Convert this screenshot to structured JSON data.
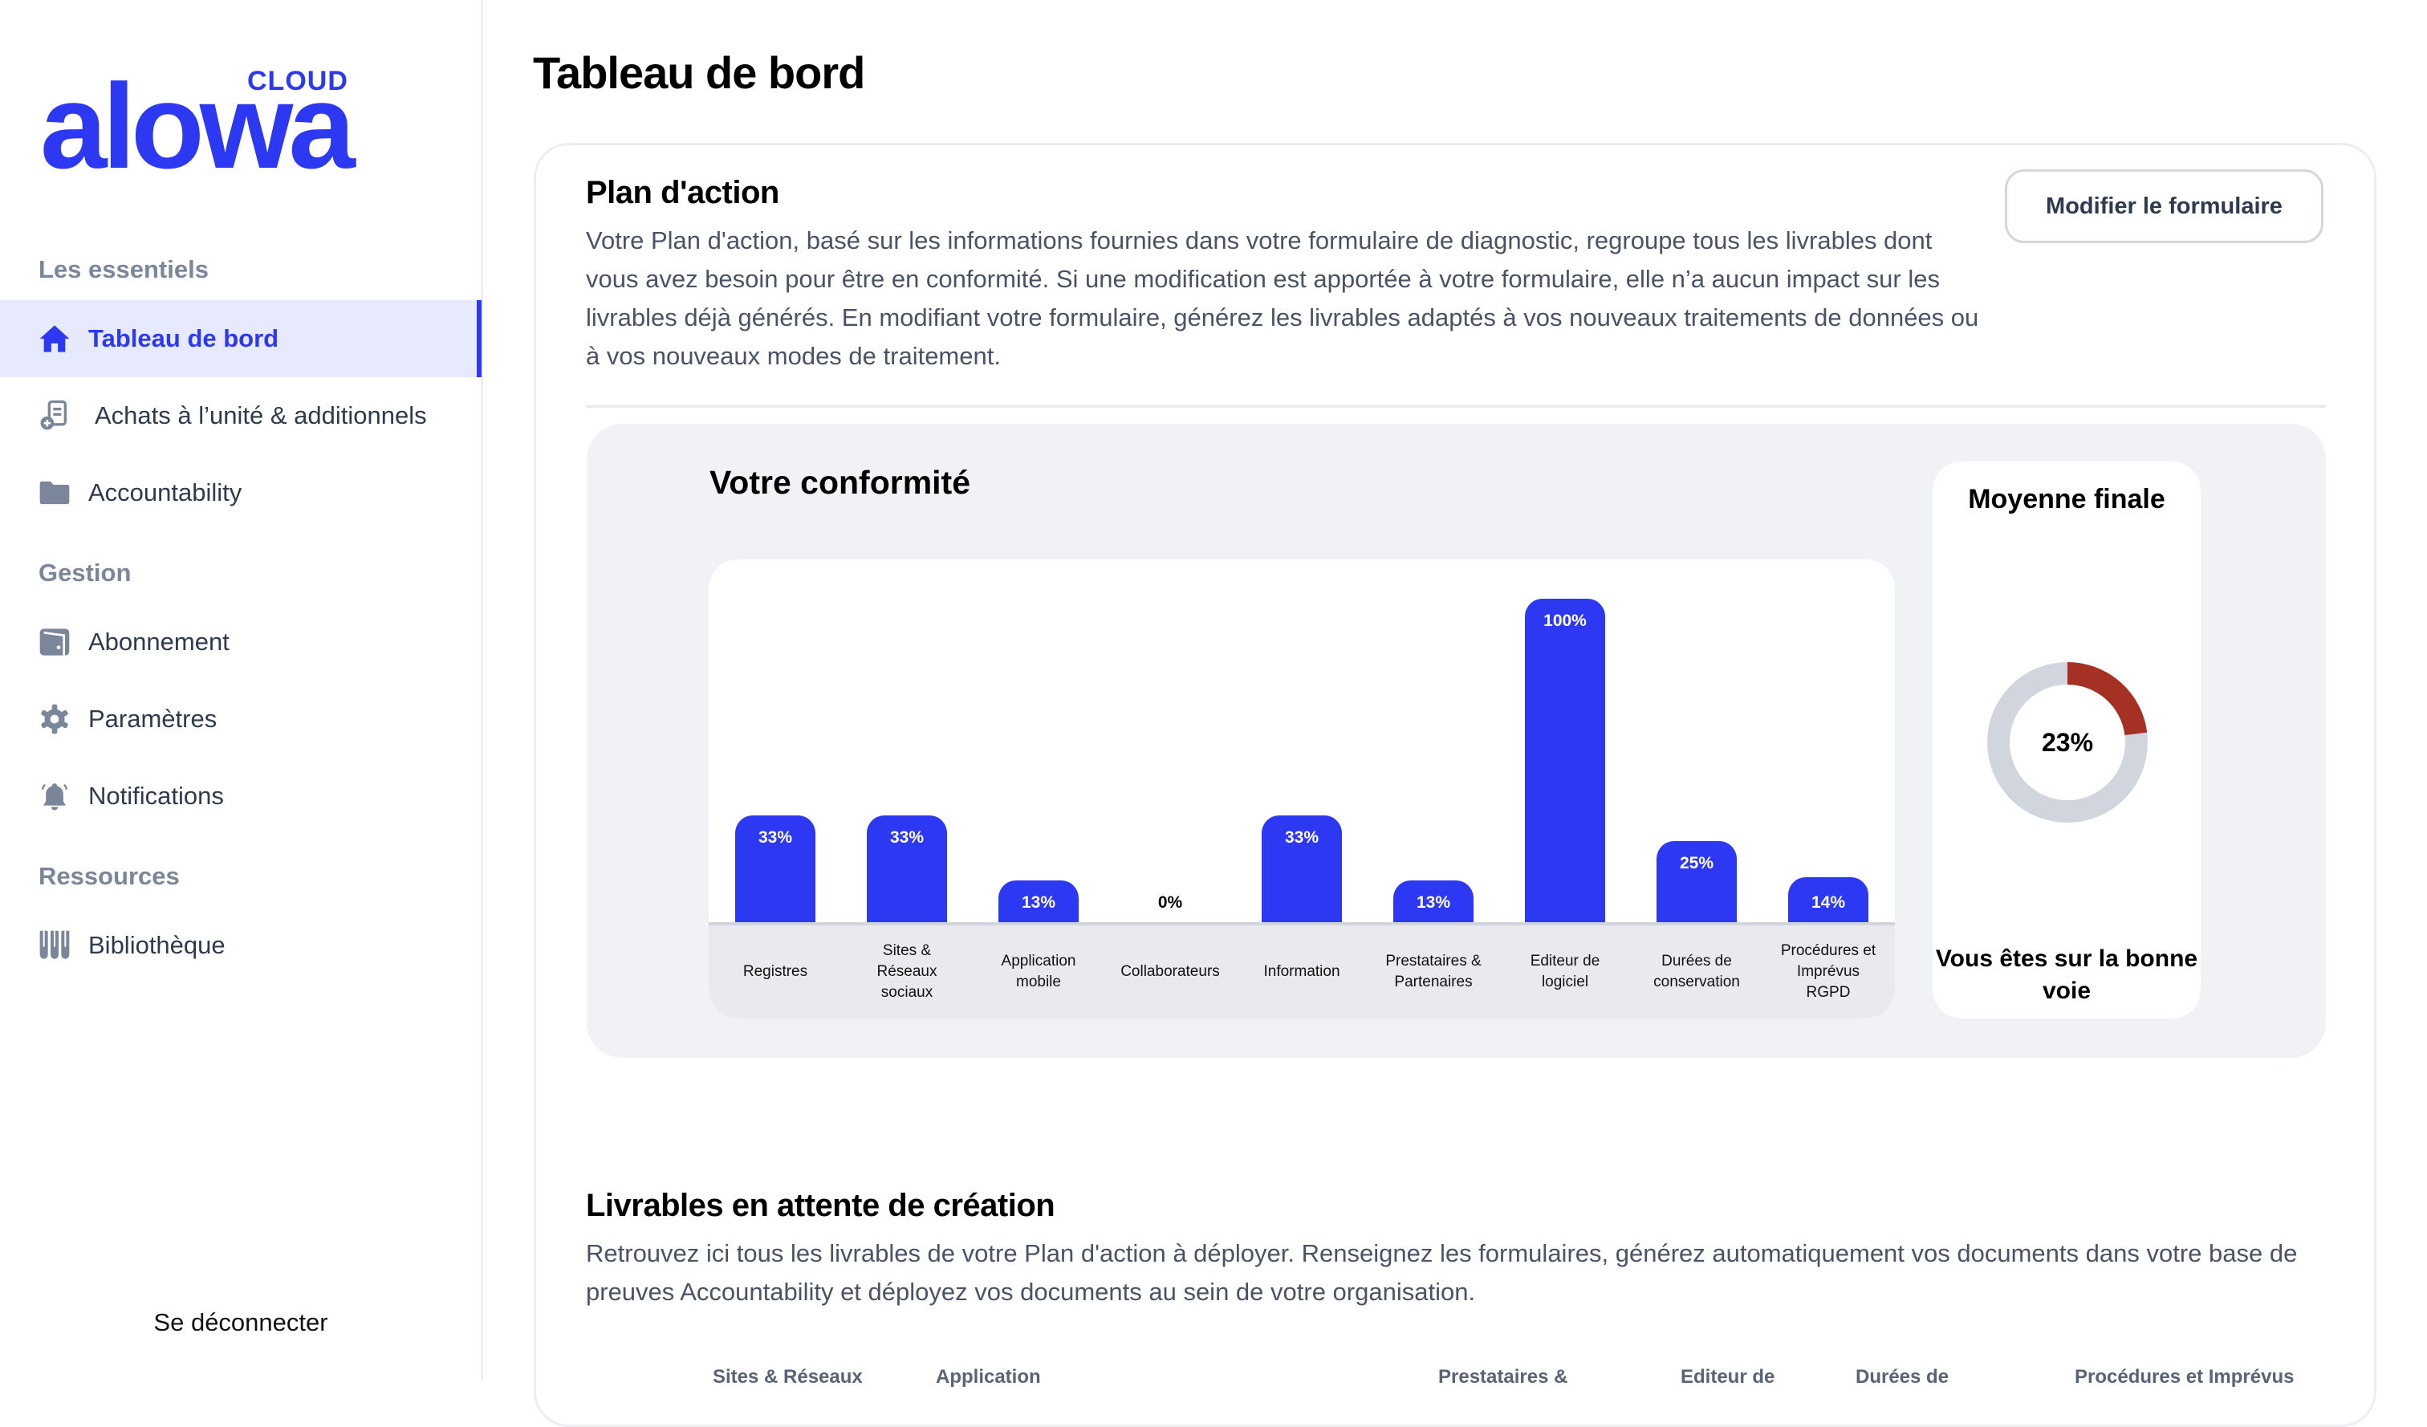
{
  "brand": {
    "name": "alowa",
    "suffix": "CLOUD",
    "accent": "#2d38f2"
  },
  "sidebar": {
    "sections": [
      {
        "label": "Les essentiels"
      },
      {
        "label": "Gestion"
      },
      {
        "label": "Ressources"
      }
    ],
    "items": [
      {
        "label": "Tableau de bord",
        "icon": "home-icon",
        "active": true
      },
      {
        "label": "Achats à l’unité & additionnels",
        "icon": "document-add-icon"
      },
      {
        "label": "Accountability",
        "icon": "folder-icon"
      },
      {
        "label": "Abonnement",
        "icon": "wallet-icon"
      },
      {
        "label": "Paramètres",
        "icon": "gear-icon"
      },
      {
        "label": "Notifications",
        "icon": "bell-icon"
      },
      {
        "label": "Bibliothèque",
        "icon": "books-icon"
      }
    ],
    "logout": "Se déconnecter"
  },
  "header": {
    "title": "Tableau de bord"
  },
  "plan": {
    "title": "Plan d'action",
    "description": "Votre Plan d'action, basé sur les informations fournies dans votre formulaire de diagnostic, regroupe tous les livrables dont vous avez besoin pour être en conformité. Si une modification est apportée à votre formulaire, elle n’a aucun impact sur les livrables déjà générés. En modifiant votre formulaire, générez les livrables adaptés à vos nouveaux traitements de données ou à vos nouveaux modes de traitement.",
    "edit_button": "Modifier le formulaire"
  },
  "conformite": {
    "title": "Votre conformité",
    "final": {
      "title": "Moyenne finale",
      "value": 23,
      "value_label": "23%",
      "message": "Vous êtes sur la bonne voie",
      "progress_color": "#a53024",
      "track_color": "#d1d5dd"
    }
  },
  "chart_data": {
    "type": "bar",
    "title": "Votre conformité",
    "xlabel": "",
    "ylabel": "",
    "ylim": [
      0,
      100
    ],
    "grid": false,
    "bar_color": "#2d38f2",
    "categories": [
      [
        "Registres"
      ],
      [
        "Sites &",
        "Réseaux",
        "sociaux"
      ],
      [
        "Application",
        "mobile"
      ],
      [
        "Collaborateurs"
      ],
      [
        "Information"
      ],
      [
        "Prestataires &",
        "Partenaires"
      ],
      [
        "Editeur de",
        "logiciel"
      ],
      [
        "Durées de",
        "conservation"
      ],
      [
        "Procédures et",
        "Imprévus",
        "RGPD"
      ]
    ],
    "values": [
      33,
      33,
      13,
      0,
      33,
      13,
      100,
      25,
      14
    ],
    "labels": [
      "33%",
      "33%",
      "13%",
      "0%",
      "33%",
      "13%",
      "100%",
      "25%",
      "14%"
    ]
  },
  "livrables": {
    "title": "Livrables en attente de création",
    "description": "Retrouvez ici tous les livrables de votre Plan d'action à déployer. Renseignez les formulaires, générez automatiquement vos documents dans votre base de preuves Accountability et déployez vos documents au sein de votre organisation.",
    "tabs": [
      "Sites & Réseaux",
      "Application",
      "Prestataires &",
      "Editeur de",
      "Durées de",
      "Procédures et Imprévus"
    ]
  }
}
